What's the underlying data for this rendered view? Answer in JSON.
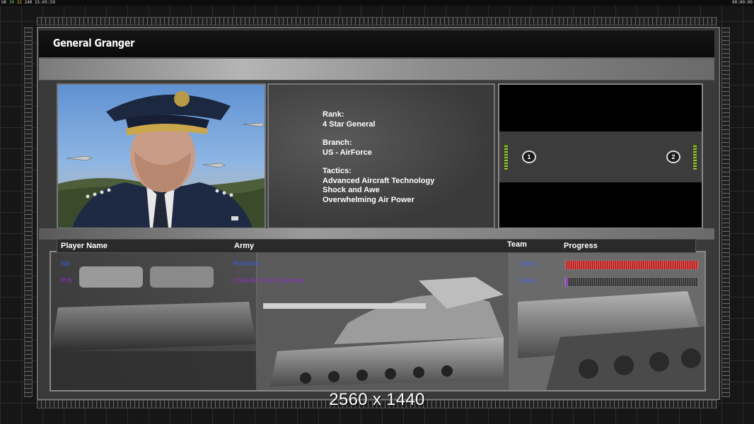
{
  "status_bar": {
    "left_prefix": "UK",
    "left_g1": "30",
    "left_g2": "32",
    "left_rest": "240",
    "clock": "15:05:59",
    "right": "00:00:00"
  },
  "header": {
    "title": "General Granger"
  },
  "general_info": {
    "rank_label": "Rank:",
    "rank_value": "4 Star General",
    "branch_label": "Branch:",
    "branch_value": "US - AirForce",
    "tactics_label": "Tactics:",
    "tactics": [
      "Advanced Aircraft Technology",
      "Shock and Awe",
      "Overwhelming Air Power"
    ]
  },
  "map": {
    "spawn_1": "1",
    "spawn_2": "2"
  },
  "table": {
    "headers": {
      "player_name": "Player Name",
      "army": "Army",
      "team": "Team",
      "progress": "Progress"
    },
    "rows": [
      {
        "player_name": "Nb",
        "army": "Random",
        "team": "None",
        "progress": 1.0
      },
      {
        "player_name": "Pr5",
        "army": "USA Air Force General",
        "team": "None",
        "progress": 0.02
      }
    ]
  },
  "overlay": {
    "resolution": "2560 x 1440"
  },
  "colors": {
    "player1": "#3a5ad8",
    "player2": "#8a30c8",
    "progress_red": "#e24848",
    "progress_purple": "#b060e0"
  }
}
